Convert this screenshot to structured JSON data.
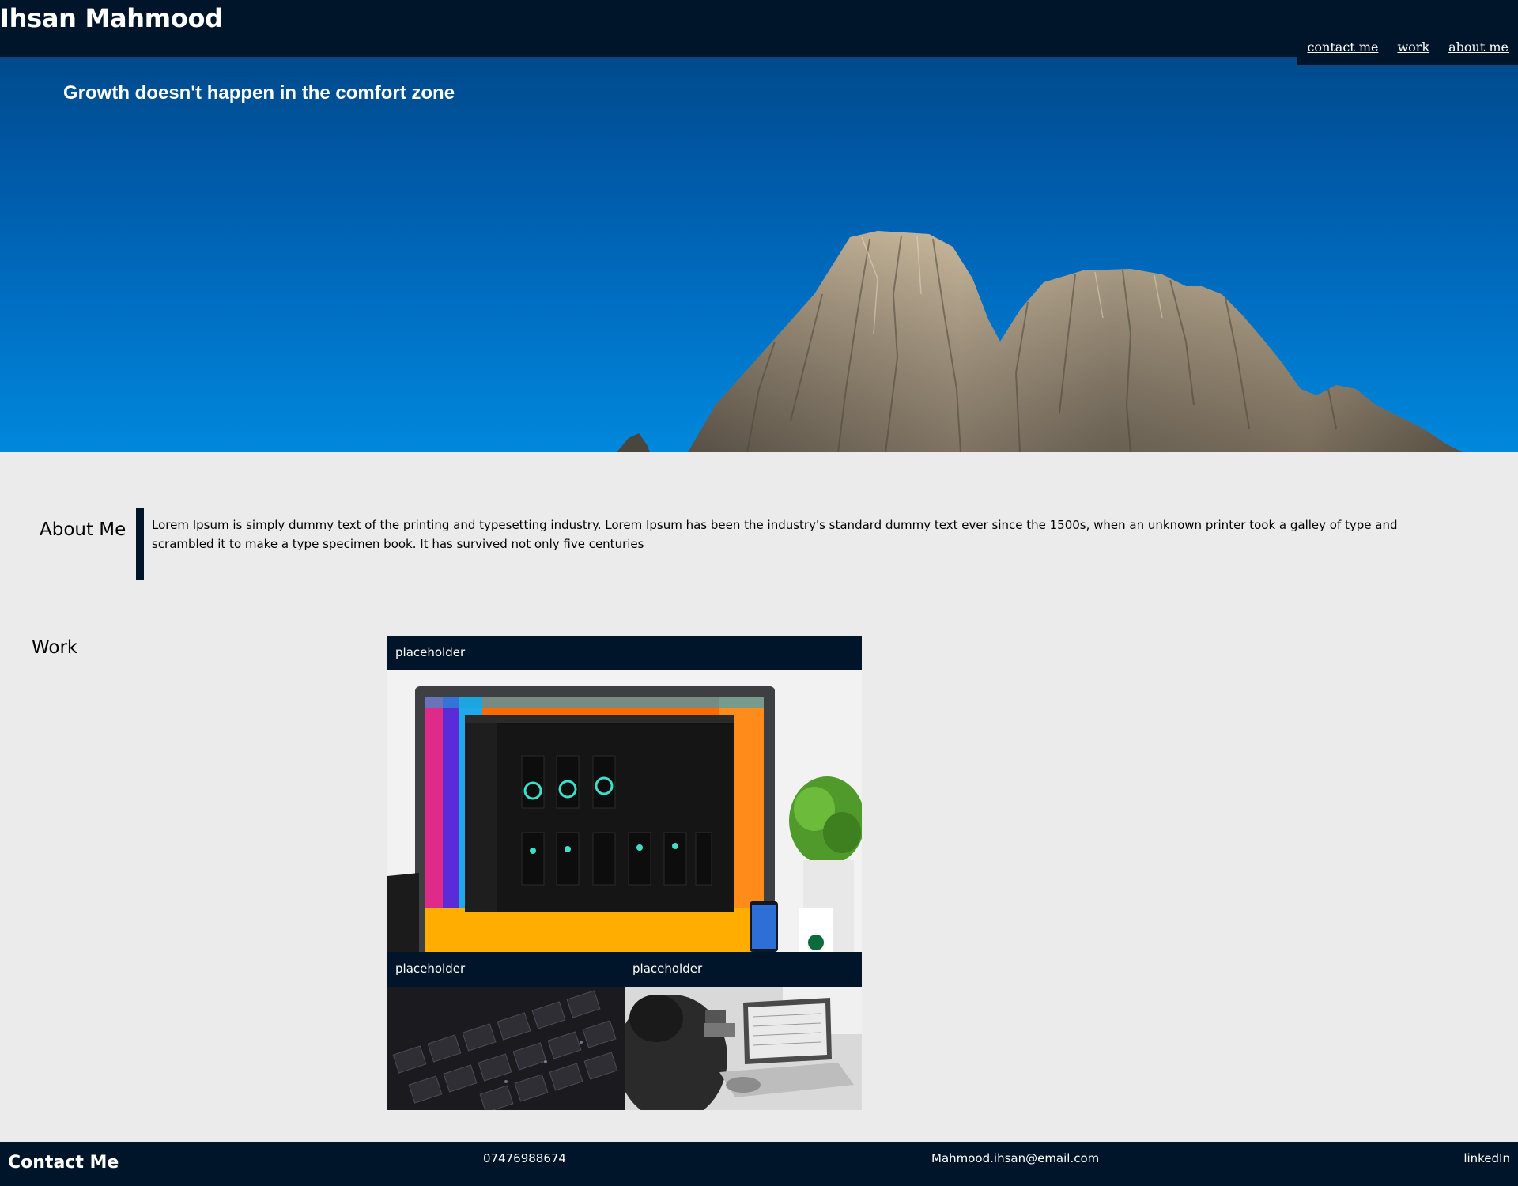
{
  "header": {
    "title": "Ihsan Mahmood",
    "nav": [
      {
        "label": "contact me"
      },
      {
        "label": "work"
      },
      {
        "label": "about me"
      }
    ]
  },
  "hero": {
    "quote": "Growth doesn't happen in the comfort zone"
  },
  "about": {
    "heading": "About Me",
    "text": "Lorem Ipsum is simply dummy text of the printing and typesetting industry. Lorem Ipsum has been the industry's standard dummy text ever since the 1500s, when an unknown printer took a galley of type and scrambled it to make a type specimen book. It has survived not only five centuries"
  },
  "work": {
    "heading": "Work",
    "cards": [
      {
        "title": "placeholder",
        "image": "desktop-monitor-photo"
      },
      {
        "title": "placeholder",
        "image": "keyboard-photo"
      },
      {
        "title": "placeholder",
        "image": "laptop-typing-photo"
      }
    ]
  },
  "footer": {
    "title": "Contact Me",
    "phone": "07476988674",
    "email": "Mahmood.ihsan@email.com",
    "linkedin": "linkedIn"
  },
  "colors": {
    "navy": "#001529",
    "page_bg": "#ebebeb",
    "sky_top": "#004a8c",
    "sky_bottom": "#0088dc"
  }
}
